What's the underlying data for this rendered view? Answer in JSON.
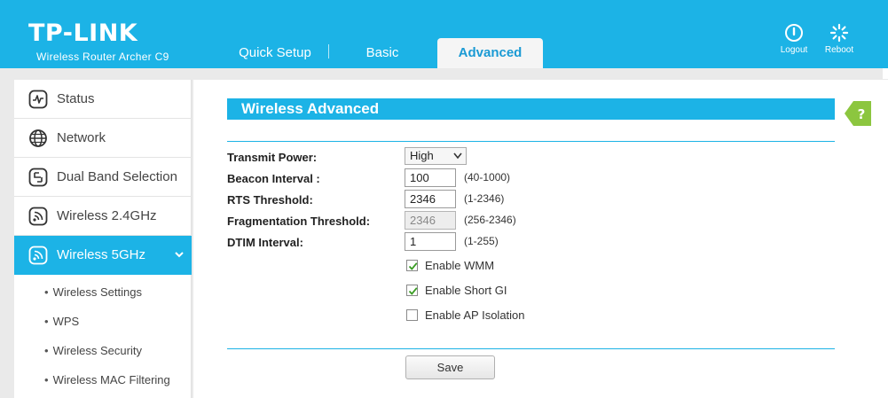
{
  "header": {
    "brand": "TP-LINK",
    "model": "Wireless Router Archer C9",
    "tabs": {
      "quick_setup": "Quick Setup",
      "basic": "Basic",
      "advanced": "Advanced"
    },
    "logout_label": "Logout",
    "reboot_label": "Reboot"
  },
  "sidebar": {
    "items": [
      {
        "label": "Status",
        "icon": "status-icon"
      },
      {
        "label": "Network",
        "icon": "globe-icon"
      },
      {
        "label": "Dual Band Selection",
        "icon": "dual-band-icon"
      },
      {
        "label": "Wireless 2.4GHz",
        "icon": "wifi-icon"
      },
      {
        "label": "Wireless 5GHz",
        "icon": "wifi-icon",
        "active": true
      }
    ],
    "sub_items": [
      "Wireless Settings",
      "WPS",
      "Wireless Security",
      "Wireless MAC Filtering"
    ]
  },
  "main": {
    "section_title": "Wireless Advanced",
    "help_label": "?",
    "fields": {
      "transmit_power": {
        "label": "Transmit Power:",
        "value": "High"
      },
      "beacon_interval": {
        "label": "Beacon Interval :",
        "value": "100",
        "range": "(40-1000)"
      },
      "rts_threshold": {
        "label": "RTS Threshold:",
        "value": "2346",
        "range": "(1-2346)"
      },
      "fragmentation_threshold": {
        "label": "Fragmentation Threshold:",
        "value": "2346",
        "range": "(256-2346)"
      },
      "dtim_interval": {
        "label": "DTIM Interval:",
        "value": "1",
        "range": "(1-255)"
      }
    },
    "checkboxes": {
      "wmm": {
        "label": "Enable WMM",
        "checked": true
      },
      "short_gi": {
        "label": "Enable Short GI",
        "checked": true
      },
      "ap_isolation": {
        "label": "Enable AP Isolation",
        "checked": false
      }
    },
    "save_label": "Save"
  },
  "colors": {
    "accent": "#1cb3e6",
    "help_green": "#8cc63f",
    "check_green": "#3a9d23"
  }
}
